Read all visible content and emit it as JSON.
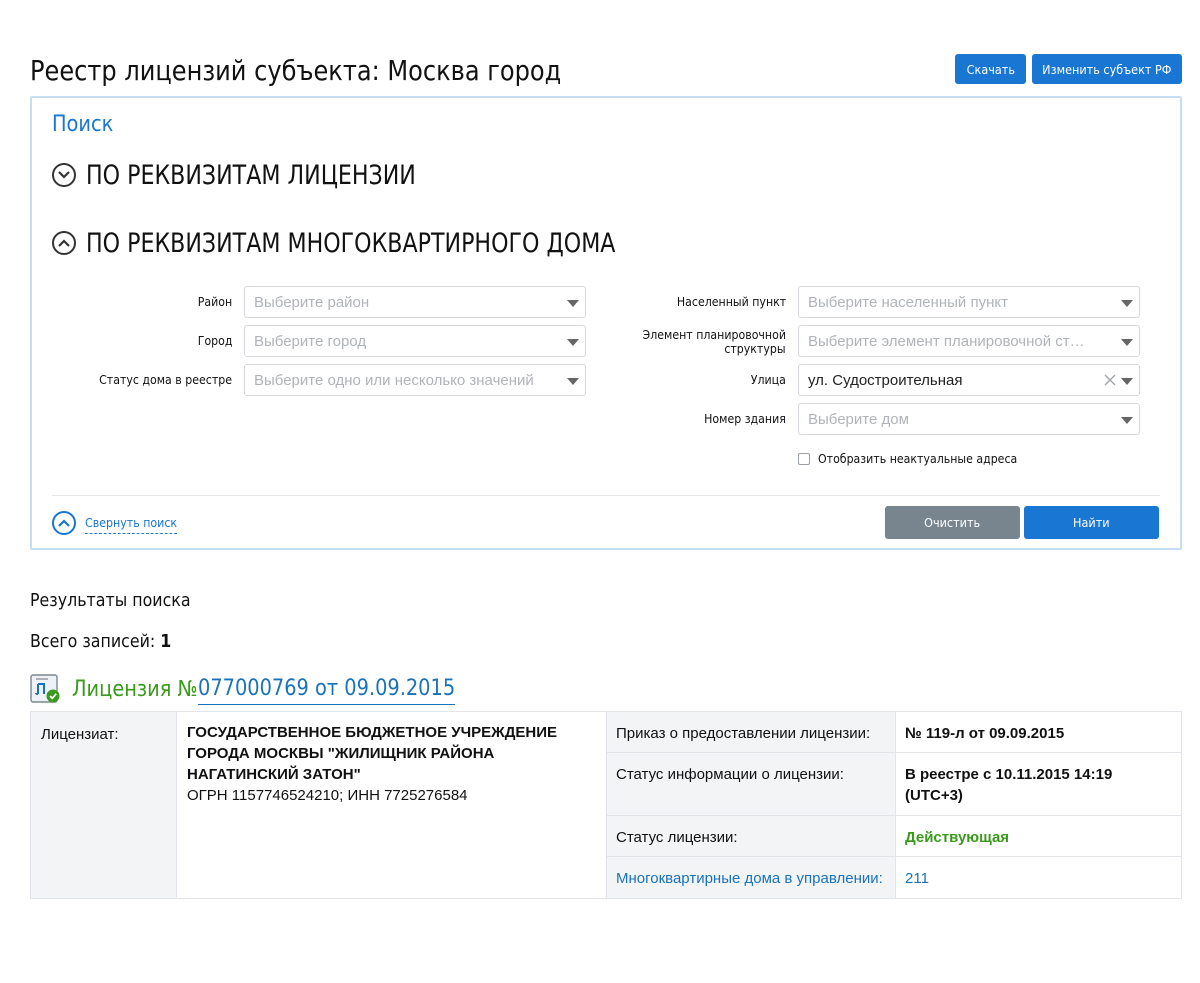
{
  "header": {
    "title": "Реестр лицензий субъекта: Москва город",
    "download_label": "Скачать",
    "change_subject_label": "Изменить субъект РФ"
  },
  "search": {
    "title": "Поиск",
    "section_license_label": "ПО РЕКВИЗИТАМ ЛИЦЕНЗИИ",
    "section_house_label": "ПО РЕКВИЗИТАМ МНОГОКВАРТИРНОГО ДОМА",
    "fields": {
      "district": {
        "label": "Район",
        "placeholder": "Выберите район"
      },
      "city": {
        "label": "Город",
        "placeholder": "Выберите город"
      },
      "house_status": {
        "label": "Статус дома в реестре",
        "placeholder": "Выберите одно или несколько значений"
      },
      "locality": {
        "label": "Населенный пункт",
        "placeholder": "Выберите населенный пункт"
      },
      "planning_element": {
        "label_line1": "Элемент планировочной",
        "label_line2": "структуры",
        "placeholder": "Выберите элемент планировочной струк…"
      },
      "street": {
        "label": "Улица",
        "value": "ул. Судостроительная"
      },
      "building": {
        "label": "Номер здания",
        "placeholder": "Выберите дом"
      }
    },
    "show_outdated_label": "Отобразить неактуальные адреса",
    "collapse_label": "Свернуть поиск",
    "clear_label": "Очистить",
    "find_label": "Найти"
  },
  "results": {
    "title": "Результаты поиска",
    "total_label": "Всего записей:",
    "total_count": "1"
  },
  "license": {
    "prefix": "Лицензия №",
    "link_text": "077000769 от 09.09.2015",
    "licensee_label": "Лицензиат:",
    "licensee_name": "ГОСУДАРСТВЕННОЕ БЮДЖЕТНОЕ УЧРЕЖДЕНИЕ ГОРОДА МОСКВЫ \"ЖИЛИЩНИК РАЙОНА НАГАТИНСКИЙ ЗАТОН\"",
    "licensee_ids": "ОГРН 1157746524210; ИНН 7725276584",
    "order_label": "Приказ о предоставлении лицензии:",
    "order_value": "№ 119-л от 09.09.2015",
    "info_status_label": "Статус информации о лицензии:",
    "info_status_value": "В реестре с 10.11.2015 14:19 (UTC+3)",
    "status_label": "Статус лицензии:",
    "status_value": "Действующая",
    "houses_label": "Многоквартирные дома в управлении:",
    "houses_value": "211"
  },
  "colors": {
    "accent": "#1976d2",
    "success": "#3a9a1c",
    "muted_button": "#78858f",
    "panel_border": "#c6ddf3"
  }
}
